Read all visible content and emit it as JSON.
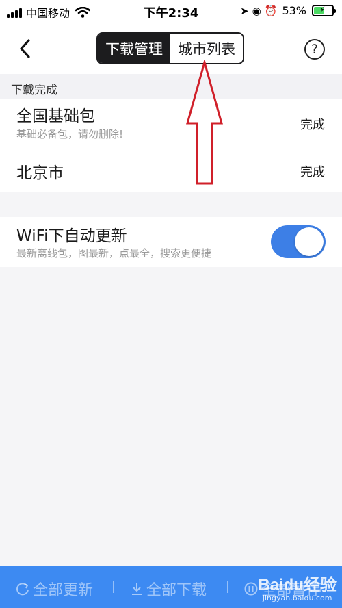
{
  "status_bar": {
    "carrier": "中国移动",
    "time": "下午2:34",
    "battery_percent": "53%",
    "battery_level": 0.53
  },
  "nav": {
    "tabs": [
      {
        "label": "下载管理",
        "active": true
      },
      {
        "label": "城市列表",
        "active": false
      }
    ],
    "help_label": "?"
  },
  "downloads": {
    "section_title": "下载完成",
    "items": [
      {
        "title": "全国基础包",
        "subtitle": "基础必备包，请勿删除!",
        "status": "完成"
      },
      {
        "title": "北京市",
        "subtitle": "",
        "status": "完成"
      }
    ]
  },
  "wifi_update": {
    "title": "WiFi下自动更新",
    "subtitle": "最新离线包，图最新，点最全，搜索更便捷",
    "enabled": true
  },
  "bottom_bar": {
    "update_all": "全部更新",
    "download_all": "全部下载",
    "pause_all": "全部暂停"
  },
  "watermark": {
    "main": "Baidu经验",
    "sub": "jingyan.baidu.com"
  },
  "colors": {
    "accent": "#3d7fe6",
    "bottom_bar": "#3d8af2",
    "annotation_arrow": "#d0202a"
  },
  "icons": {
    "back": "chevron-left-icon",
    "help": "question-circle-icon",
    "refresh": "refresh-icon",
    "download": "download-icon",
    "pause": "pause-icon"
  }
}
